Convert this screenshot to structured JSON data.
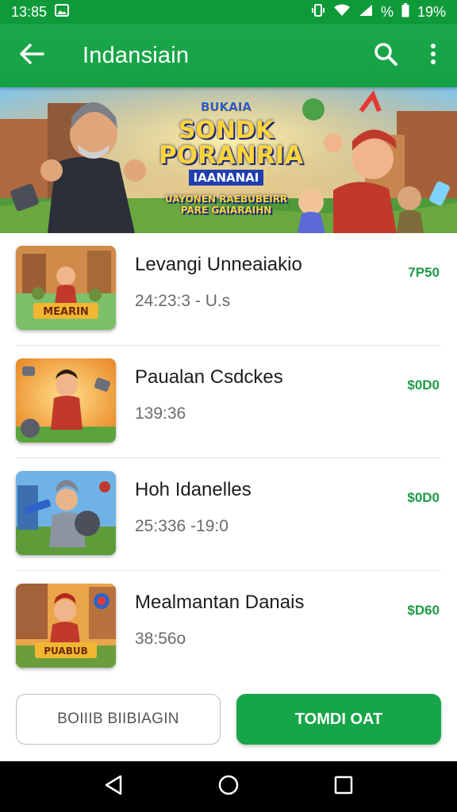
{
  "status_bar": {
    "time": "13:85",
    "battery_percent": "19%",
    "percent_sign": "%",
    "icons": [
      "image-icon",
      "vibrate-icon",
      "wifi-icon",
      "signal-icon",
      "battery-icon"
    ]
  },
  "app_bar": {
    "title": "Indansiain",
    "back_icon": "arrow-left-icon",
    "search_icon": "search-icon",
    "menu_icon": "more-vertical-icon"
  },
  "banner": {
    "line1": "BUKAIA",
    "line2": "SONDK",
    "line3": "PORANRIA",
    "line4": "IAANANAI",
    "line5": "UAYONEN RAEBUBEIRR PARE GAIARAIHN"
  },
  "games": [
    {
      "name": "Levangi Unneaiakio",
      "meta": "24:23:3 - U.s",
      "price": "7P50",
      "thumb_caption": "MEARIN"
    },
    {
      "name": "Paualan Csdckes",
      "meta": "139:36",
      "price": "$0D0",
      "thumb_caption": ""
    },
    {
      "name": "Hoh Idanelles",
      "meta": "25:336 -19:0",
      "price": "$0D0",
      "thumb_caption": ""
    },
    {
      "name": "Mealmantan Danais",
      "meta": "38:56o",
      "price": "$D60",
      "thumb_caption": "PUABUB"
    }
  ],
  "actions": {
    "secondary_label": "BOIIIB BIIBIAGIN",
    "primary_label": "TOMDI OAT"
  },
  "colors": {
    "primary_green": "#16a548",
    "price_green": "#1f9a47"
  },
  "nav": {
    "back_icon": "triangle-back-icon",
    "home_icon": "circle-home-icon",
    "recents_icon": "square-recents-icon"
  }
}
